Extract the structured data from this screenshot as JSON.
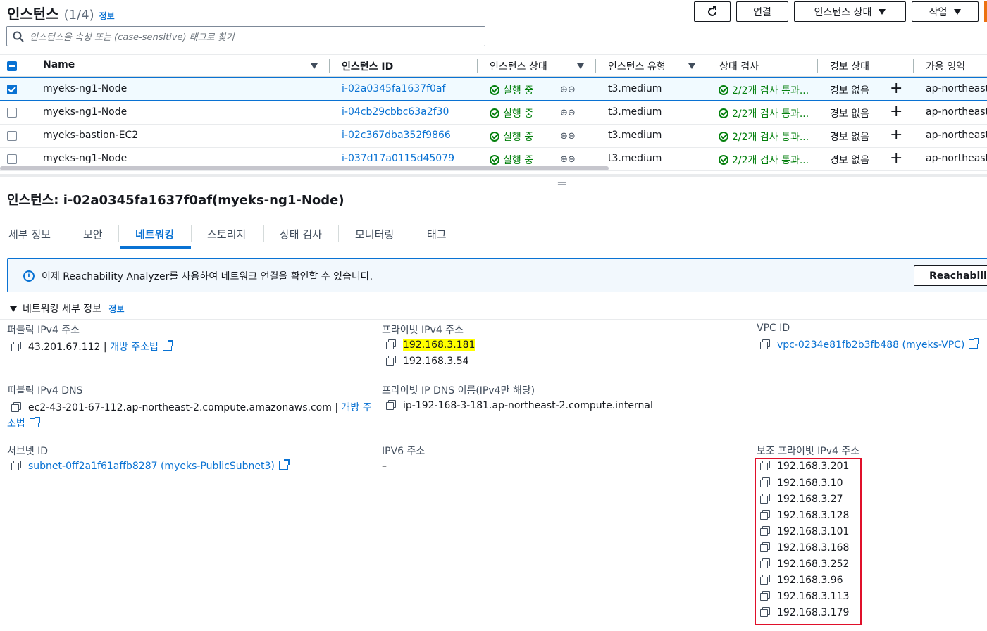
{
  "header": {
    "title": "인스턴스",
    "count": "(1/4)",
    "info_link": "정보",
    "search_placeholder": "인스턴스을 속성 또는 (case-sensitive) 태그로 찾기",
    "buttons": {
      "connect": "연결",
      "instance_state": "인스턴스 상태",
      "actions": "작업"
    }
  },
  "table": {
    "columns": [
      "Name",
      "인스턴스 ID",
      "인스턴스 상태",
      "인스턴스 유형",
      "상태 검사",
      "경보 상태",
      "가용 영역"
    ],
    "rows": [
      {
        "name": "myeks-ng1-Node",
        "id": "i-02a0345fa1637f0af",
        "state": "실행 중",
        "type": "t3.medium",
        "check": "2/2개 검사 통과...",
        "alarm": "경보 없음",
        "az": "ap-northeast",
        "selected": true
      },
      {
        "name": "myeks-ng1-Node",
        "id": "i-04cb29cbbc63a2f30",
        "state": "실행 중",
        "type": "t3.medium",
        "check": "2/2개 검사 통과...",
        "alarm": "경보 없음",
        "az": "ap-northeast",
        "selected": false
      },
      {
        "name": "myeks-bastion-EC2",
        "id": "i-02c367dba352f9866",
        "state": "실행 중",
        "type": "t3.medium",
        "check": "2/2개 검사 통과...",
        "alarm": "경보 없음",
        "az": "ap-northeast",
        "selected": false
      },
      {
        "name": "myeks-ng1-Node",
        "id": "i-037d17a0115d45079",
        "state": "실행 중",
        "type": "t3.medium",
        "check": "2/2개 검사 통과...",
        "alarm": "경보 없음",
        "az": "ap-northeast",
        "selected": false
      }
    ],
    "plus": "+",
    "zoom": "⊕⊖"
  },
  "detail": {
    "resize_handle": "=",
    "title": "인스턴스: i-02a0345fa1637f0af(myeks-ng1-Node)",
    "tabs": [
      "세부 정보",
      "보안",
      "네트워킹",
      "스토리지",
      "상태 검사",
      "모니터링",
      "태그"
    ],
    "active_tab": "네트워킹",
    "info_banner": "이제 Reachability Analyzer를 사용하여 네트워크 연결을 확인할 수 있습니다.",
    "info_button": "Reachability",
    "section_title": "네트워킹 세부 정보",
    "section_info": "정보",
    "public_ipv4_label": "퍼블릭 IPv4 주소",
    "public_ipv4": "43.201.67.112",
    "open_address": "개방 주소법",
    "private_ipv4_label": "프라이빗 IPv4 주소",
    "private_ipv4": [
      "192.168.3.181",
      "192.168.3.54"
    ],
    "vpc_label": "VPC ID",
    "vpc": "vpc-0234e81fb2b3fb488 (myeks-VPC)",
    "public_dns_label": "퍼블릭 IPv4 DNS",
    "public_dns": "ec2-43-201-67-112.ap-northeast-2.compute.amazonaws.com",
    "open_address_part1": "개방 주",
    "open_address_part2": "소법",
    "private_dns_label": "프라이빗 IP DNS 이름(IPv4만 해당)",
    "private_dns": "ip-192-168-3-181.ap-northeast-2.compute.internal",
    "subnet_label": "서브넷 ID",
    "subnet": "subnet-0ff2a1f61affb8287 (myeks-PublicSubnet3)",
    "ipv6_label": "IPV6 주소",
    "ipv6": "–",
    "secondary_label": "보조 프라이빗 IPv4 주소",
    "secondary": [
      "192.168.3.201",
      "192.168.3.10",
      "192.168.3.27",
      "192.168.3.128",
      "192.168.3.101",
      "192.168.3.168",
      "192.168.3.252",
      "192.168.3.96",
      "192.168.3.113",
      "192.168.3.179"
    ]
  }
}
